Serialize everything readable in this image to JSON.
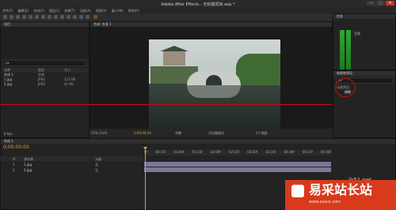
{
  "window": {
    "title": "Adobe After Effects - 无标题项目.aep *",
    "minimize": "─",
    "maximize": "□",
    "close": "✕"
  },
  "menu": [
    "文件(F)",
    "编辑(E)",
    "合成(C)",
    "图层(L)",
    "效果(T)",
    "动画(A)",
    "视图(V)",
    "窗口(W)",
    "帮助(H)"
  ],
  "project_panel": {
    "tab": "项目",
    "search_placeholder": "ρ▾",
    "columns": [
      "名称",
      "类型",
      "大小"
    ],
    "items": [
      {
        "name": "合成 1",
        "type": "合成",
        "size": ""
      },
      {
        "name": "1.jpg",
        "type": "JPEG",
        "size": "221 KB"
      },
      {
        "name": "2.jpg",
        "type": "JPEG",
        "size": "41 KB"
      }
    ],
    "footer": "8 bpc"
  },
  "composition_panel": {
    "tab": "合成: 合成 1",
    "zoom": "25% (Full)",
    "timecode": "0;00;00;00",
    "quality": "完整",
    "camera": "活动摄像机",
    "view": "1个视图"
  },
  "right_panel": {
    "info_tab": "信息",
    "audio_tab": "音频",
    "effects_tab": "效果和预设",
    "search_value": "ρ▾",
    "tree_item": "动画预设",
    "highlight_item": "模糊"
  },
  "timeline": {
    "tab": "合成 1",
    "timecode": "0;00;00;00",
    "layer_columns": [
      "#",
      "源名称",
      "父级"
    ],
    "layers": [
      {
        "index": "1",
        "name": "1.jpg",
        "parent": "无"
      },
      {
        "index": "2",
        "name": "2.jpg",
        "parent": "无"
      }
    ],
    "ruler": [
      "0f",
      "00:15f",
      "01:00f",
      "01:15f",
      "02:00f",
      "02:15f",
      "03:00f",
      "03:15f",
      "04:00f",
      "04:15f",
      "05:00f"
    ]
  },
  "watermark": {
    "site": "易采站长站",
    "url": "www.easck.com",
    "small": "jb51.net"
  },
  "colors": {
    "accent_red": "#c40f0f",
    "meter_green": "#2ea82e",
    "timecode_orange": "#e59f2b",
    "track_purple": "#7a7896"
  }
}
